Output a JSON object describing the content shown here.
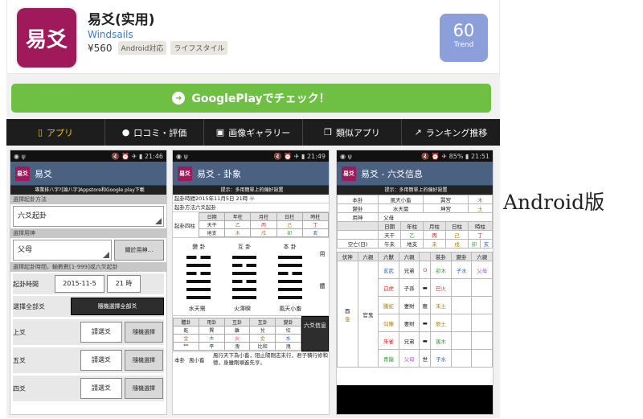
{
  "app": {
    "icon_text": "易爻",
    "title": "易爻(实用)",
    "developer": "Windsails",
    "price": "¥560",
    "tags": [
      "Android対応",
      "ライフスタイル"
    ],
    "trend_value": "60",
    "trend_label": "Trend"
  },
  "googleplay_button": "GooglePlayでチェック！",
  "tabs": [
    {
      "label": "アプリ",
      "icon": "phone-icon"
    },
    {
      "label": "口コミ・評価",
      "icon": "speech-bubble-icon"
    },
    {
      "label": "画像ギャラリー",
      "icon": "image-icon"
    },
    {
      "label": "類似アプリ",
      "icon": "copy-icon"
    },
    {
      "label": "ランキング推移",
      "icon": "chart-icon"
    }
  ],
  "side_label": "Android版",
  "screen1": {
    "time": "21:46",
    "title": "易爻",
    "banner": "專業排八字?[論八字]Appstore和Google play下載",
    "method_label": "選擇起卦方法",
    "method_value": "六爻起卦",
    "yongshen_label": "選擇用神",
    "yongshen_value": "父母",
    "about_btn": "關於用神…",
    "number_label": "選擇起卦時間，輸數數[1-999]或六爻起卦",
    "time_label": "起卦時間",
    "date_value": "2015-11-5",
    "hour_value": "21 時",
    "all_label": "選擇全部爻",
    "all_btn": "隨機選擇全部爻",
    "yao_rows": [
      "上爻",
      "五爻",
      "四爻"
    ],
    "select_btn": "請選爻",
    "random_btn": "隨機選擇"
  },
  "screen2": {
    "time": "21:49",
    "title": "易爻 - 卦象",
    "banner": "提示：多用簡單上的偏好設置",
    "info1": "起卦時間2015年11月5日 21時",
    "info1_suffix": "半",
    "info2": "起卦方法六爻起卦",
    "pillar_label": "起卦四柱",
    "pillars": [
      "日期",
      "年柱",
      "月柱",
      "日柱",
      "時柱"
    ],
    "tiangan": [
      "天干",
      "乙",
      "丙",
      "己",
      "丁"
    ],
    "dizhi": [
      "地支",
      "未",
      "戌",
      "卯",
      "亥"
    ],
    "hex_headers": [
      "變 卦",
      "互 卦",
      "本 卦"
    ],
    "hex_names": [
      "水天需",
      "火澤睽",
      "風天小畜"
    ],
    "side_words": [
      "用",
      "體"
    ],
    "bottom_headers": [
      "體卦",
      "用卦",
      "互卦",
      "互卦",
      "變卦"
    ],
    "bottom_vals": [
      "乾",
      "巽",
      "離",
      "兌",
      "坎"
    ],
    "bottom_wx": [
      "金",
      "木",
      "火",
      "金",
      "水"
    ],
    "bottom_rel": [
      "**",
      "平",
      "洩",
      "比和",
      "洩"
    ],
    "side_btn": "六爻信息",
    "bengua_label": "本卦",
    "bengua_name": "風小畜",
    "bengua_text": "風行天下為小畜，阻止陽剛志未行，君子積行修和德，身雖剛順進先亨。"
  },
  "screen3": {
    "time": "21:51",
    "battery": "85%",
    "title": "易爻 - 六爻信息",
    "banner": "提示：多用簡單上的偏好設置",
    "rows": [
      [
        "本卦",
        "風天小畜",
        "巽宮",
        "木"
      ],
      [
        "變卦",
        "水天需",
        "坤宮",
        "土"
      ],
      [
        "用神",
        "父母"
      ],
      [
        "",
        "日期",
        "年柱",
        "月柱",
        "日柱",
        "時柱"
      ],
      [
        "",
        "天干",
        "乙",
        "丙",
        "己",
        "丁"
      ],
      [
        "空亡(日)",
        "午未",
        "地支",
        "未",
        "戌",
        "卯",
        "亥"
      ]
    ],
    "grid_headers": [
      "伏神",
      "六親",
      "六獸",
      "六親",
      "",
      "裝卦",
      "變卦",
      "六親"
    ],
    "beasts": [
      "玄武",
      "白虎",
      "騰蛇",
      "勾陳",
      "朱雀",
      "青龍"
    ],
    "fushen": [
      "官鬼"
    ],
    "fu_left": "酉",
    "fu_left2": "金",
    "liuqin": [
      "兄弟",
      "子孫",
      "妻財",
      "妻財",
      "兄弟",
      "父母"
    ],
    "zhuanggua": [
      "卯木",
      "巳火",
      "未土",
      "辰土",
      "寅木",
      "子水"
    ],
    "markers": [
      "O",
      "應",
      "世"
    ],
    "bian": [
      "子水"
    ],
    "bian_q": "父母"
  }
}
